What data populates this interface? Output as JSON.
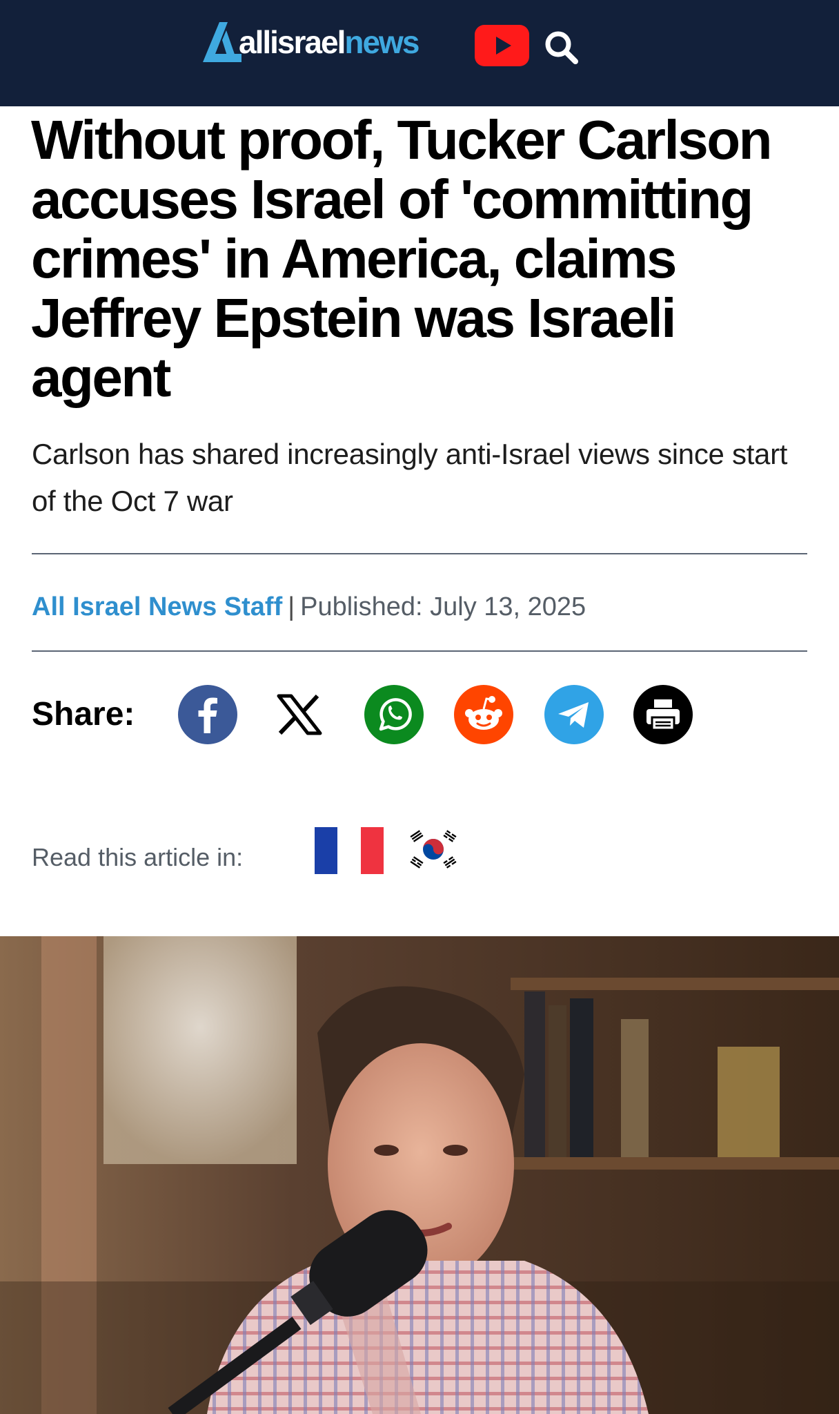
{
  "header": {
    "logo_part1": "allisrael",
    "logo_part2": "news",
    "youtube_icon": "youtube-icon",
    "search_icon": "search-icon",
    "bg_color": "#12203a",
    "accent_color": "#3fa9e0"
  },
  "article": {
    "headline": "Without proof, Tucker Carlson accuses Israel of 'committing crimes' in America, claims Jeffrey Epstein was Israeli agent",
    "subheadline": "Carlson has shared increasingly anti-Israel views since start of the Oct 7 war",
    "author": "All Israel News Staff",
    "separator": "|",
    "published": "Published: July 13, 2025"
  },
  "share": {
    "label": "Share:",
    "buttons": [
      {
        "name": "facebook",
        "icon": "facebook-icon",
        "color": "#3b5998"
      },
      {
        "name": "x",
        "icon": "x-icon",
        "color": "#000000"
      },
      {
        "name": "whatsapp",
        "icon": "whatsapp-icon",
        "color": "#0b8a1f"
      },
      {
        "name": "reddit",
        "icon": "reddit-icon",
        "color": "#ff4500"
      },
      {
        "name": "telegram",
        "icon": "telegram-icon",
        "color": "#30a3e6"
      },
      {
        "name": "print",
        "icon": "print-icon",
        "color": "#000000"
      }
    ]
  },
  "translations": {
    "label": "Read this article in:",
    "languages": [
      {
        "name": "French",
        "icon": "france-flag-icon"
      },
      {
        "name": "Korean",
        "icon": "south-korea-flag-icon"
      }
    ]
  },
  "hero_image": {
    "icon": "article-photo"
  }
}
